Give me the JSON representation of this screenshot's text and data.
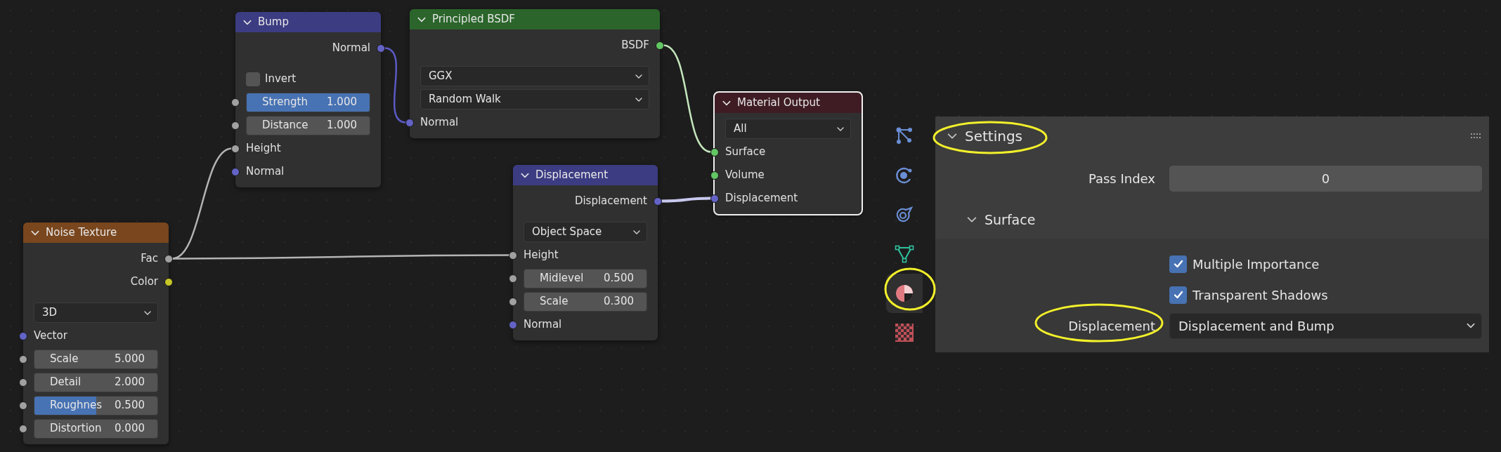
{
  "nodes": [
    {
      "title": "Bump",
      "color": "#3c3c83",
      "selected": false,
      "rows": [
        {
          "kind": "output",
          "label": "Normal",
          "color": "#6363c7"
        },
        {
          "kind": "checkbox",
          "label": "Invert",
          "checked": false
        },
        {
          "kind": "slider",
          "label": "Strength",
          "value": "1.000",
          "level": 1,
          "color": "#a1a1a1"
        },
        {
          "kind": "number",
          "label": "Distance",
          "value": "1.000",
          "color": "#a1a1a1"
        },
        {
          "kind": "input",
          "label": "Height",
          "color": "#a1a1a1"
        },
        {
          "kind": "input",
          "label": "Normal",
          "color": "#6363c7"
        }
      ]
    },
    {
      "title": "Principled BSDF",
      "color": "#2b652b",
      "selected": false,
      "rows": [
        {
          "kind": "output",
          "label": "BSDF",
          "color": "#63c763"
        },
        {
          "kind": "dropdown",
          "value": "GGX"
        },
        {
          "kind": "dropdown",
          "value": "Random Walk"
        },
        {
          "kind": "input",
          "label": "Normal",
          "color": "#6363c7"
        }
      ]
    },
    {
      "title": "Material Output",
      "color": "#3f1c24",
      "selected": true,
      "rows": [
        {
          "kind": "dropdown",
          "value": "All"
        },
        {
          "kind": "input",
          "label": "Surface",
          "color": "#63c763"
        },
        {
          "kind": "input",
          "label": "Volume",
          "color": "#63c763"
        },
        {
          "kind": "input",
          "label": "Displacement",
          "color": "#6363c7"
        }
      ]
    },
    {
      "title": "Displacement",
      "color": "#3c3c83",
      "selected": false,
      "rows": [
        {
          "kind": "output",
          "label": "Displacement",
          "color": "#6363c7"
        },
        {
          "kind": "dropdown",
          "value": "Object Space"
        },
        {
          "kind": "input",
          "label": "Height",
          "color": "#a1a1a1"
        },
        {
          "kind": "number",
          "label": "Midlevel",
          "value": "0.500",
          "color": "#a1a1a1"
        },
        {
          "kind": "number",
          "label": "Scale",
          "value": "0.300",
          "color": "#a1a1a1"
        },
        {
          "kind": "input",
          "label": "Normal",
          "color": "#6363c7"
        }
      ]
    },
    {
      "title": "Noise Texture",
      "color": "#79461d",
      "selected": false,
      "rows": [
        {
          "kind": "output",
          "label": "Fac",
          "color": "#a1a1a1"
        },
        {
          "kind": "output",
          "label": "Color",
          "color": "#c7c729"
        },
        {
          "kind": "dropdown",
          "value": "3D"
        },
        {
          "kind": "input",
          "label": "Vector",
          "color": "#6363c7"
        },
        {
          "kind": "number",
          "label": "Scale",
          "value": "5.000",
          "color": "#a1a1a1"
        },
        {
          "kind": "number",
          "label": "Detail",
          "value": "2.000",
          "color": "#a1a1a1"
        },
        {
          "kind": "slider",
          "label": "Roughnes",
          "value": "0.500",
          "level": 0.5,
          "color": "#a1a1a1"
        },
        {
          "kind": "number",
          "label": "Distortion",
          "value": "0.000",
          "color": "#a1a1a1"
        }
      ]
    }
  ],
  "properties": {
    "tabs": [
      {
        "kind": "node",
        "selected": false
      },
      {
        "kind": "physics",
        "selected": false
      },
      {
        "kind": "constraint",
        "selected": false
      },
      {
        "kind": "data",
        "selected": false
      },
      {
        "kind": "material",
        "selected": true
      },
      {
        "kind": "texture",
        "selected": false
      }
    ],
    "panel": {
      "title": "Settings",
      "expanded": true,
      "pass_index": {
        "label": "Pass Index",
        "value": "0"
      },
      "subpanel": {
        "title": "Surface",
        "expanded": true,
        "checkboxes": [
          {
            "label": "Multiple Importance",
            "checked": true
          },
          {
            "label": "Transparent Shadows",
            "checked": true
          }
        ],
        "displacement": {
          "label": "Displacement",
          "value": "Displacement and Bump"
        }
      }
    }
  }
}
